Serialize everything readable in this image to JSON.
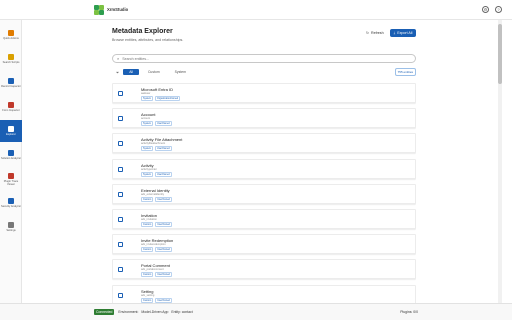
{
  "app": {
    "name": "XrmStudio"
  },
  "topbar": {
    "settings_icon": "gear-icon",
    "help_icon": "help-icon"
  },
  "sidebar": {
    "items": [
      {
        "label": "Quick Actions",
        "icon": "bolt-icon",
        "color": "#e07b00"
      },
      {
        "label": "Search Scripts",
        "icon": "code-icon",
        "color": "#d9a000"
      },
      {
        "label": "Record Inspector",
        "icon": "search-icon",
        "color": "#1a5fb4"
      },
      {
        "label": "Form Inspector",
        "icon": "form-icon",
        "color": "#c0392b"
      },
      {
        "label": "Explorer",
        "icon": "table-icon",
        "color": "#ffffff",
        "active": true
      },
      {
        "label": "Solution Analyzer",
        "icon": "solution-icon",
        "color": "#1a5fb4"
      },
      {
        "label": "Plugin Trace Viewer",
        "icon": "plugin-icon",
        "color": "#c0392b"
      },
      {
        "label": "Security Analyzer",
        "icon": "shield-icon",
        "color": "#1a5fb4"
      },
      {
        "label": "Settings",
        "icon": "gear-icon",
        "color": "#777777"
      }
    ]
  },
  "header": {
    "title": "Metadata Explorer",
    "subtitle": "Browse entities, attributes, and relationships.",
    "refresh_label": "Refresh",
    "export_label": "Export All"
  },
  "search": {
    "placeholder": "Search entities..."
  },
  "filters": {
    "chips": [
      "All",
      "Custom",
      "System"
    ],
    "active": "All",
    "count_label": "755 entities"
  },
  "entities": [
    {
      "title": "Microsoft Entra ID",
      "logical": "aaduser",
      "tags": [
        "System",
        "OrganizationOwned"
      ]
    },
    {
      "title": "Account",
      "logical": "account",
      "tags": [
        "System",
        "UserOwned"
      ]
    },
    {
      "title": "Activity File Attachment",
      "logical": "activityfileattachment",
      "tags": [
        "System",
        "UserOwned"
      ]
    },
    {
      "title": "Activity",
      "logical": "activitypointer",
      "tags": [
        "System",
        "UserOwned"
      ]
    },
    {
      "title": "External Identity",
      "logical": "adx_externalidentity",
      "tags": [
        "Custom",
        "UserOwned"
      ]
    },
    {
      "title": "Invitation",
      "logical": "adx_invitation",
      "tags": [
        "Custom",
        "UserOwned"
      ]
    },
    {
      "title": "Invite Redemption",
      "logical": "adx_inviteredemption",
      "tags": [
        "Custom",
        "UserOwned"
      ]
    },
    {
      "title": "Portal Comment",
      "logical": "adx_portalcomment",
      "tags": [
        "Custom",
        "UserOwned"
      ]
    },
    {
      "title": "Setting",
      "logical": "adx_setting",
      "tags": [
        "Custom",
        "UserOwned"
      ]
    }
  ],
  "status": {
    "badge": "Connected",
    "environment": "Environment:",
    "app": "Model-Driven App",
    "entity": "Entity: contact",
    "plugins": "Plugins: 0/0"
  },
  "colors": {
    "accent": "#1a5fb4",
    "connected": "#2e7d32"
  }
}
